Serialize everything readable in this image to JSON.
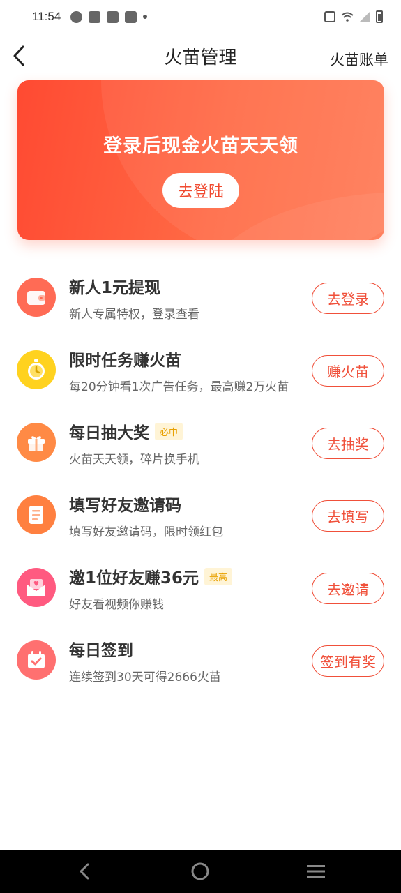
{
  "status_bar": {
    "time": "11:54",
    "icons_left": [
      "clock-icon",
      "mail-icon",
      "mail-icon",
      "mail-icon",
      "dot-icon"
    ],
    "icons_right": [
      "vibrate-icon",
      "wifi-icon",
      "signal-icon",
      "battery-icon"
    ]
  },
  "nav": {
    "back_icon": "chevron-left-icon",
    "title": "火苗管理",
    "right_label": "火苗账单"
  },
  "banner": {
    "title": "登录后现金火苗天天领",
    "button_label": "去登陆",
    "colors": {
      "start": "#ff4a32",
      "end": "#ff7a55"
    }
  },
  "tasks": [
    {
      "title": "新人1元提现",
      "badge": "",
      "desc": "新人专属特权，登录查看",
      "button": "去登录",
      "icon": "wallet-icon",
      "icon_color": "#ff6b55"
    },
    {
      "title": "限时任务赚火苗",
      "badge": "",
      "desc": "每20分钟看1次广告任务，最高赚2万火苗",
      "button": "赚火苗",
      "icon": "stopwatch-icon",
      "icon_color": "#ffd21f"
    },
    {
      "title": "每日抽大奖",
      "badge": "必中",
      "desc": "火苗天天领，碎片换手机",
      "button": "去抽奖",
      "icon": "gift-icon",
      "icon_color": "#ff8a45"
    },
    {
      "title": "填写好友邀请码",
      "badge": "",
      "desc": "填写好友邀请码，限时领红包",
      "button": "去填写",
      "icon": "document-icon",
      "icon_color": "#ff8040"
    },
    {
      "title": "邀1位好友赚36元",
      "badge": "最高",
      "desc": "好友看视频你赚钱",
      "button": "去邀请",
      "icon": "invite-envelope-icon",
      "icon_color": "#ff5a80"
    },
    {
      "title": "每日签到",
      "badge": "",
      "desc": "连续签到30天可得2666火苗",
      "button": "签到有奖",
      "icon": "calendar-check-icon",
      "icon_color": "#ff7070"
    }
  ],
  "accent_color": "#f0503a",
  "system_nav": [
    "back-icon",
    "home-icon",
    "menu-icon"
  ]
}
